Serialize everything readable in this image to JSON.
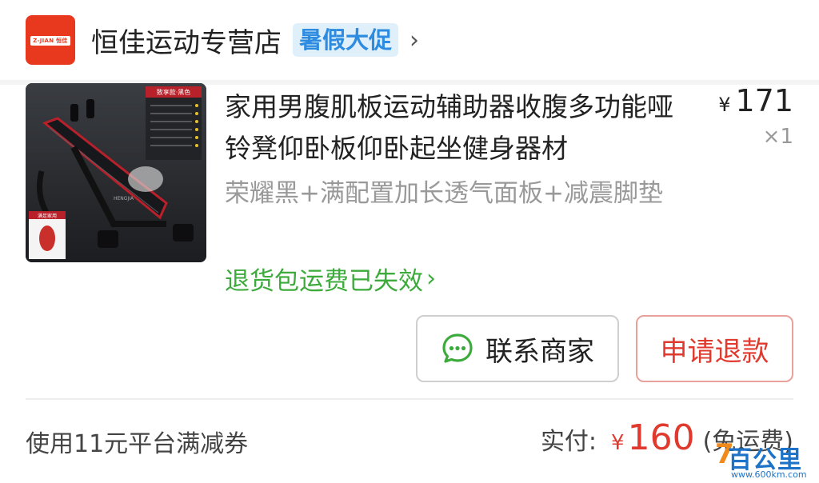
{
  "store": {
    "logo_text": "Z-JIAN 恒佳",
    "name": "恒佳运动专营店",
    "promo_badge": "暑假大促",
    "chevron": "›"
  },
  "product": {
    "title": "家用男腹肌板运动辅助器收腹多功能哑铃凳仰卧板仰卧起坐健身器材",
    "currency": "¥",
    "price": "171",
    "quantity": "×1",
    "spec": "荣耀黑+满配置加长透气面板+减震脚垫",
    "return_notice": "退货包运费已失效",
    "return_chevron": "›",
    "thumb_tag": "致享款·黑色",
    "thumb_badge": "满足家用",
    "thumb_brand": "HENGJIA"
  },
  "actions": {
    "contact_label": "联系商家",
    "refund_label": "申请退款"
  },
  "footer": {
    "coupon_note": "使用11元平台满减券",
    "paid_label": "实付:",
    "paid_currency": "¥",
    "paid_amount": "160",
    "shipping_note": "(免运费)"
  },
  "watermark": {
    "text": "百公里",
    "url": "www.600km.com"
  },
  "colors": {
    "accent_red": "#e03a2f",
    "green": "#3cab3c",
    "promo_blue": "#2d8be0",
    "logo_red": "#e8391f"
  },
  "icons": {
    "chat": "chat-bubble-icon",
    "chevron": "chevron-right-icon"
  }
}
